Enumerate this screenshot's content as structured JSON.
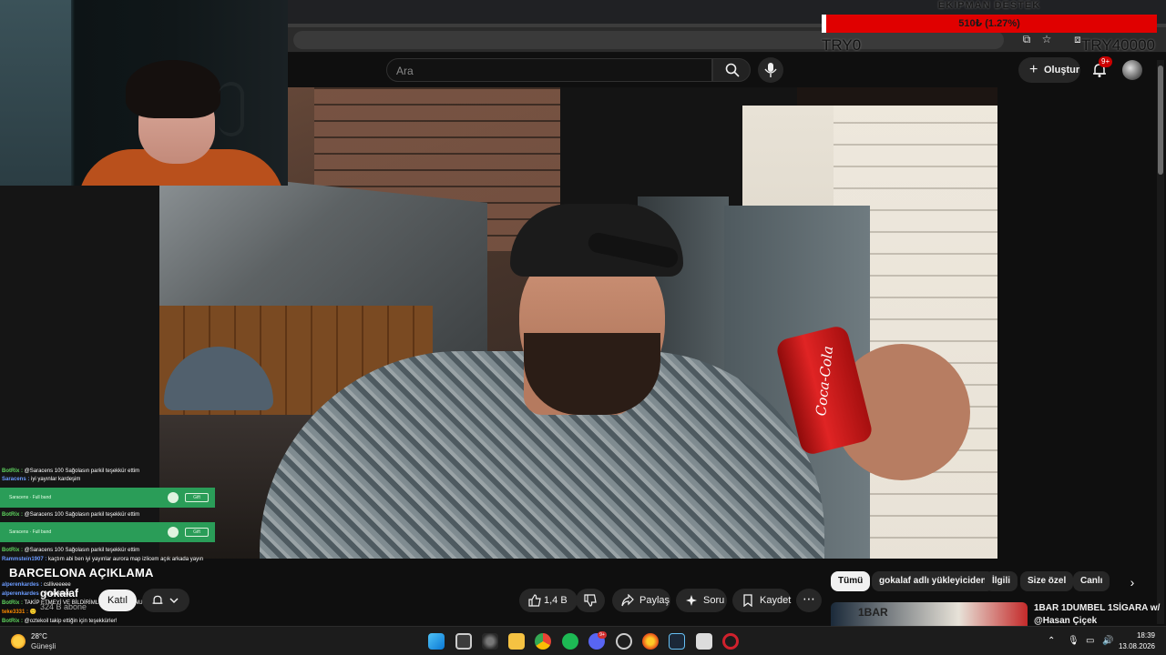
{
  "overlay": {
    "donation_title": "EKİPMAN DESTEK",
    "donation_amount": "510₺ (1.27%)",
    "goal_min": "TRY0",
    "goal_max": "TRY40000",
    "progress_percent": 1.27
  },
  "header": {
    "search_placeholder": "Ara",
    "create_label": "Oluştur",
    "notifications_badge": "9+"
  },
  "video": {
    "title": "BARCELONA AÇIKLAMA",
    "channel": "gokalaf",
    "subscribers": "324 B abone",
    "join_label": "Katıl",
    "like_count": "1,4 B",
    "share_label": "Paylaş",
    "ask_label": "Soru",
    "save_label": "Kaydet",
    "can_text": "Coca-Cola"
  },
  "chips": [
    {
      "label": "Tümü",
      "active": true
    },
    {
      "label": "gokalaf adlı yükleyiciden",
      "active": false
    },
    {
      "label": "İlgili",
      "active": false
    },
    {
      "label": "Size özel",
      "active": false
    },
    {
      "label": "Canlı",
      "active": false
    }
  ],
  "recommended": {
    "thumb_text": "1BAR",
    "title_line1": "1BAR 1DUMBEL 1SİGARA w/",
    "title_line2": "@Hasan Çiçek"
  },
  "chat": {
    "l1_user": "BotRix :",
    "l1_msg": "@Saracens 100 Sağolasın parkil teşekkür ettim",
    "l2_user": "Saracens :",
    "l2_msg": "iyi yayınlar kardeşim",
    "g1_text": "Saracens · Full band",
    "g_btn": "Gift",
    "l3_user": "BotRix :",
    "l3_msg": "@Saracens 100 Sağolasın parkil teşekkür ettim",
    "g2_text": "Saracens · Full band",
    "l4_user": "BotRix :",
    "l4_msg": "@Saracens 100 Sağolasın parkil teşekkür ettim",
    "l5_user": "Rammstein1907 :",
    "l5_msg": "kaçtım abi ben iyi yayınlar aurora map izlicem açık arkada yayın",
    "l6_user": "alperenkardes :",
    "l6_msg": "cslliveeeee",
    "l7_user": "alperenkardes :",
    "l7_msg": "suveeeeee",
    "l8_user": "BotRix :",
    "l8_msg": "TAKİP ETMEYİ VE BİLDİRİMLERİ AÇMAYI UNUTMAYIN",
    "l9_user": "teke3331 :",
    "l9_msg": "🙂",
    "l10_user": "BotRix :",
    "l10_msg": "@oztekoil takip ettiğin için teşekkürler!"
  },
  "taskbar": {
    "temperature": "28°C",
    "weather": "Güneşli",
    "time": "18:39",
    "date": "13.08.2026",
    "discord_badge": "9+"
  },
  "colors": {
    "accent_red": "#e00000",
    "yt_bg": "#0f0f0f",
    "chat_green": "#2a9d58"
  }
}
